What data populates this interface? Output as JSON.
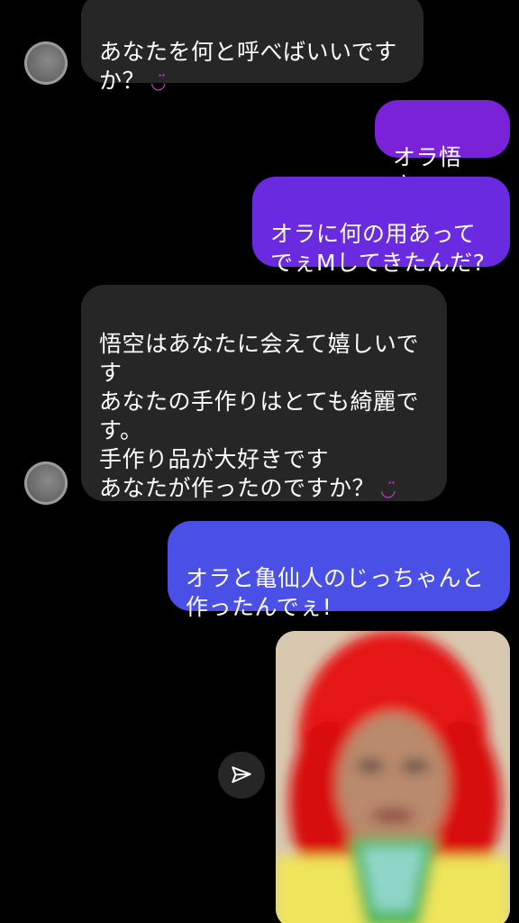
{
  "messages": [
    {
      "id": 1,
      "direction": "incoming",
      "text": "あなたを何と呼べばいいです\nか？",
      "emoji": "◡̈"
    },
    {
      "id": 2,
      "direction": "outgoing",
      "text": "オラ悟空!"
    },
    {
      "id": 3,
      "direction": "outgoing",
      "text": "オラに何の用あって\nでぇMしてきたんだ?"
    },
    {
      "id": 4,
      "direction": "incoming",
      "text": "悟空はあなたに会えて嬉しいで\nす\nあなたの手作りはとても綺麗で\nす。\n手作り品が大好きです\nあなたが作ったのですか？",
      "emoji": "◡̈"
    },
    {
      "id": 5,
      "direction": "outgoing",
      "text": "オラと亀仙人のじっちゃんと\n作ったんでぇ!"
    }
  ],
  "colors": {
    "background": "#000000",
    "incoming_bubble": "#262626",
    "outgoing_bubble_1": "#7a22d8",
    "outgoing_bubble_2": "#6a2ae0",
    "outgoing_bubble_3": "#4a50e6",
    "emoji": "#d535d5"
  },
  "icons": {
    "share": "paper-plane-icon",
    "avatar": "avatar"
  },
  "photo": {
    "description_icon": "photo-attachment"
  }
}
